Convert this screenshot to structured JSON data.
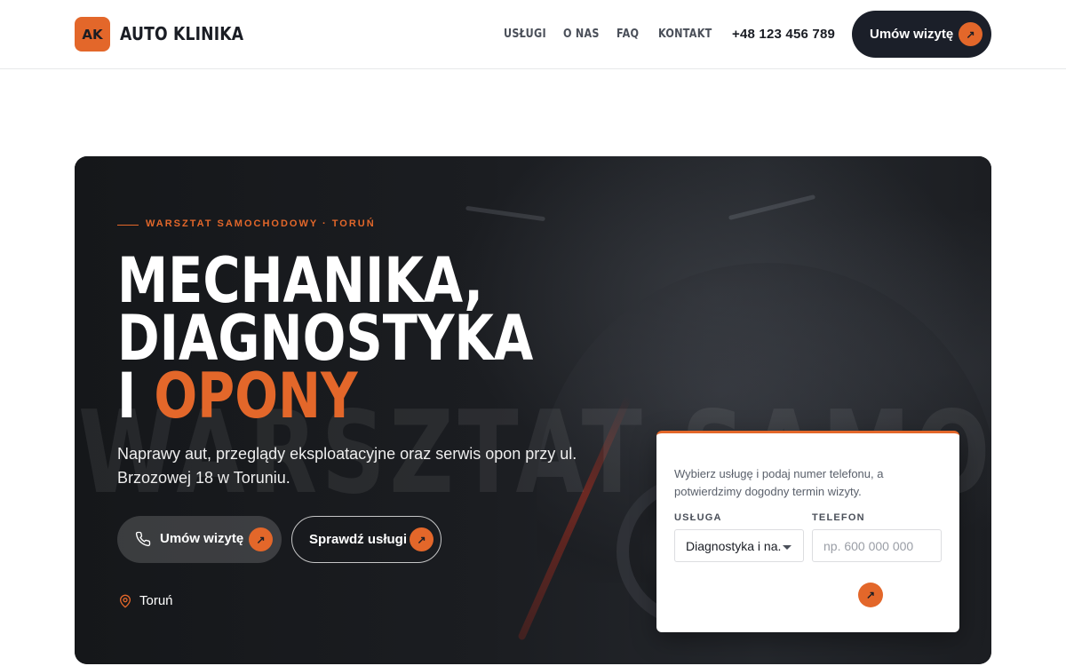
{
  "header": {
    "logo_badge": "AK",
    "brand": "AUTO KLINIKA",
    "nav": [
      {
        "label": "USŁUGI"
      },
      {
        "label": "O NAS"
      },
      {
        "label": "FAQ"
      },
      {
        "label": "KONTAKT"
      }
    ],
    "phone": "+48 123 456 789",
    "cta_label": "Umów wizytę",
    "cta_icon": "arrow-up-right-icon"
  },
  "hero": {
    "eyebrow": "WARSZTAT SAMOCHODOWY · TORUŃ",
    "headline_line1": "MECHANIKA,",
    "headline_line2": "DIAGNOSTYKA",
    "headline_line3_prefix": "I ",
    "headline_line3_accent": "OPONY",
    "watermark": "WARSZTAT SAMOCH",
    "lead": "Naprawy aut, przeglądy eksploatacyjne oraz serwis opon przy ul. Brzozowej 18 w Toruniu.",
    "primary_button": "Umów wizytę",
    "secondary_button": "Sprawdź usługi",
    "location": "Toruń"
  },
  "form": {
    "intro": "Wybierz usługę i podaj numer telefonu, a potwierdzimy dogodny termin wizyty.",
    "service_label": "USŁUGA",
    "service_value": "Diagnostyka i na...",
    "phone_label": "TELEFON",
    "phone_placeholder": "np. 600 000 000",
    "submit_icon": "arrow-up-right-icon"
  },
  "colors": {
    "accent": "#e3672a",
    "dark": "#1b1f29"
  }
}
